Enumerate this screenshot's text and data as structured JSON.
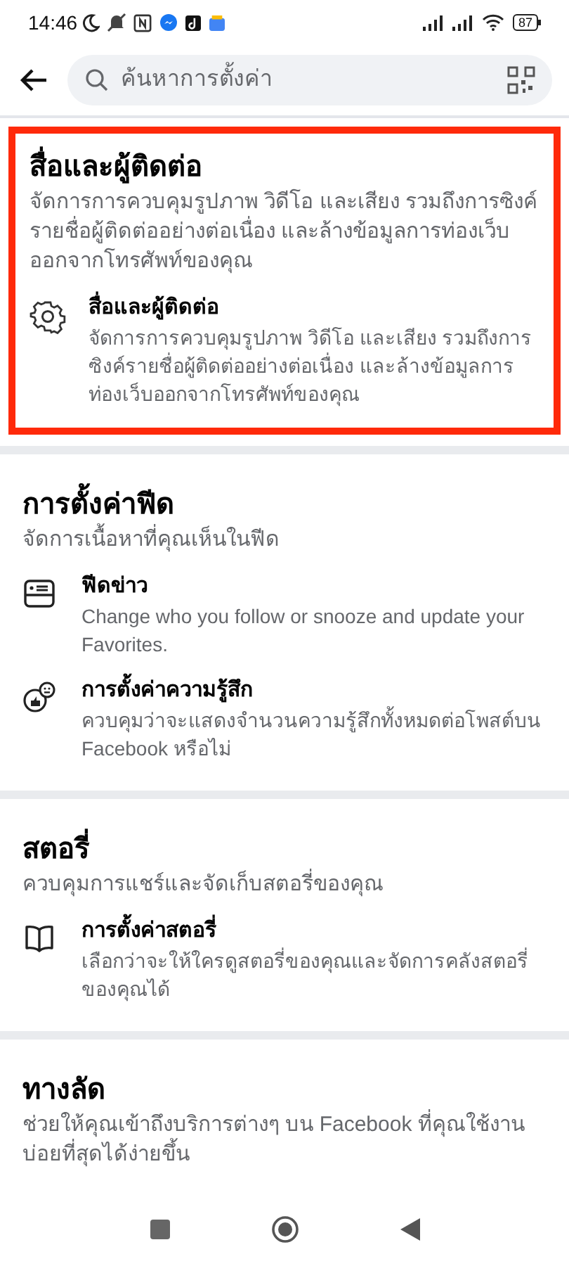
{
  "status_bar": {
    "time": "14:46",
    "battery": "87"
  },
  "search": {
    "placeholder": "ค้นหาการตั้งค่า"
  },
  "sections": [
    {
      "title": "สื่อและผู้ติดต่อ",
      "description": "จัดการการควบคุมรูปภาพ วิดีโอ และเสียง รวมถึงการซิงค์รายชื่อผู้ติดต่ออย่างต่อเนื่อง และล้างข้อมูลการท่องเว็บออกจากโทรศัพท์ของคุณ",
      "highlighted": true,
      "items": [
        {
          "kind": "gear",
          "title": "สื่อและผู้ติดต่อ",
          "description": "จัดการการควบคุมรูปภาพ วิดีโอ และเสียง รวมถึงการซิงค์รายชื่อผู้ติดต่ออย่างต่อเนื่อง และล้างข้อมูลการท่องเว็บออกจากโทรศัพท์ของคุณ"
        }
      ]
    },
    {
      "title": "การตั้งค่าฟีด",
      "description": "จัดการเนื้อหาที่คุณเห็นในฟีด",
      "highlighted": false,
      "items": [
        {
          "kind": "feed",
          "title": "ฟีดข่าว",
          "description": "Change who you follow or snooze and update your Favorites."
        },
        {
          "kind": "reaction",
          "title": "การตั้งค่าความรู้สึก",
          "description": "ควบคุมว่าจะแสดงจำนวนความรู้สึกทั้งหมดต่อโพสต์บน Facebook หรือไม่"
        }
      ]
    },
    {
      "title": "สตอรี่",
      "description": "ควบคุมการแชร์และจัดเก็บสตอรี่ของคุณ",
      "highlighted": false,
      "items": [
        {
          "kind": "book",
          "title": "การตั้งค่าสตอรี่",
          "description": "เลือกว่าจะให้ใครดูสตอรี่ของคุณและจัดการคลังสตอรี่ของคุณได้"
        }
      ]
    },
    {
      "title": "ทางลัด",
      "description": "ช่วยให้คุณเข้าถึงบริการต่างๆ บน Facebook ที่คุณใช้งานบ่อยที่สุดได้ง่ายขึ้น",
      "highlighted": false
    }
  ]
}
